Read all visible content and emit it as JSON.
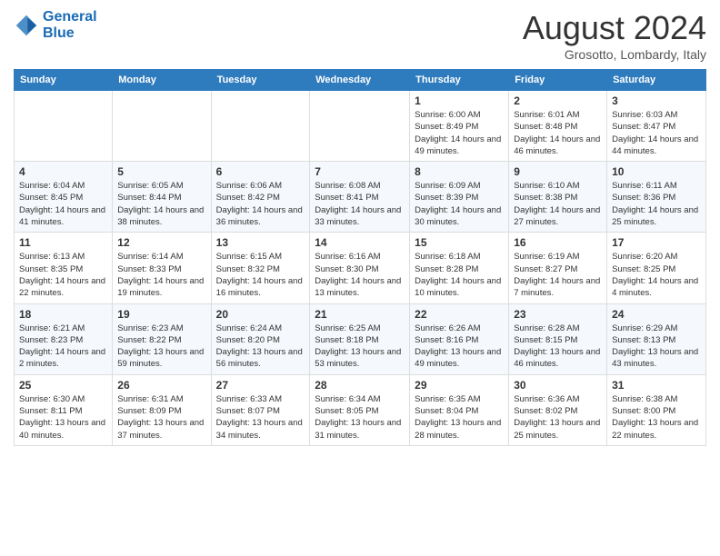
{
  "header": {
    "logo_line1": "General",
    "logo_line2": "Blue",
    "month_title": "August 2024",
    "subtitle": "Grosotto, Lombardy, Italy"
  },
  "weekdays": [
    "Sunday",
    "Monday",
    "Tuesday",
    "Wednesday",
    "Thursday",
    "Friday",
    "Saturday"
  ],
  "weeks": [
    [
      {
        "day": "",
        "info": ""
      },
      {
        "day": "",
        "info": ""
      },
      {
        "day": "",
        "info": ""
      },
      {
        "day": "",
        "info": ""
      },
      {
        "day": "1",
        "info": "Sunrise: 6:00 AM\nSunset: 8:49 PM\nDaylight: 14 hours and 49 minutes."
      },
      {
        "day": "2",
        "info": "Sunrise: 6:01 AM\nSunset: 8:48 PM\nDaylight: 14 hours and 46 minutes."
      },
      {
        "day": "3",
        "info": "Sunrise: 6:03 AM\nSunset: 8:47 PM\nDaylight: 14 hours and 44 minutes."
      }
    ],
    [
      {
        "day": "4",
        "info": "Sunrise: 6:04 AM\nSunset: 8:45 PM\nDaylight: 14 hours and 41 minutes."
      },
      {
        "day": "5",
        "info": "Sunrise: 6:05 AM\nSunset: 8:44 PM\nDaylight: 14 hours and 38 minutes."
      },
      {
        "day": "6",
        "info": "Sunrise: 6:06 AM\nSunset: 8:42 PM\nDaylight: 14 hours and 36 minutes."
      },
      {
        "day": "7",
        "info": "Sunrise: 6:08 AM\nSunset: 8:41 PM\nDaylight: 14 hours and 33 minutes."
      },
      {
        "day": "8",
        "info": "Sunrise: 6:09 AM\nSunset: 8:39 PM\nDaylight: 14 hours and 30 minutes."
      },
      {
        "day": "9",
        "info": "Sunrise: 6:10 AM\nSunset: 8:38 PM\nDaylight: 14 hours and 27 minutes."
      },
      {
        "day": "10",
        "info": "Sunrise: 6:11 AM\nSunset: 8:36 PM\nDaylight: 14 hours and 25 minutes."
      }
    ],
    [
      {
        "day": "11",
        "info": "Sunrise: 6:13 AM\nSunset: 8:35 PM\nDaylight: 14 hours and 22 minutes."
      },
      {
        "day": "12",
        "info": "Sunrise: 6:14 AM\nSunset: 8:33 PM\nDaylight: 14 hours and 19 minutes."
      },
      {
        "day": "13",
        "info": "Sunrise: 6:15 AM\nSunset: 8:32 PM\nDaylight: 14 hours and 16 minutes."
      },
      {
        "day": "14",
        "info": "Sunrise: 6:16 AM\nSunset: 8:30 PM\nDaylight: 14 hours and 13 minutes."
      },
      {
        "day": "15",
        "info": "Sunrise: 6:18 AM\nSunset: 8:28 PM\nDaylight: 14 hours and 10 minutes."
      },
      {
        "day": "16",
        "info": "Sunrise: 6:19 AM\nSunset: 8:27 PM\nDaylight: 14 hours and 7 minutes."
      },
      {
        "day": "17",
        "info": "Sunrise: 6:20 AM\nSunset: 8:25 PM\nDaylight: 14 hours and 4 minutes."
      }
    ],
    [
      {
        "day": "18",
        "info": "Sunrise: 6:21 AM\nSunset: 8:23 PM\nDaylight: 14 hours and 2 minutes."
      },
      {
        "day": "19",
        "info": "Sunrise: 6:23 AM\nSunset: 8:22 PM\nDaylight: 13 hours and 59 minutes."
      },
      {
        "day": "20",
        "info": "Sunrise: 6:24 AM\nSunset: 8:20 PM\nDaylight: 13 hours and 56 minutes."
      },
      {
        "day": "21",
        "info": "Sunrise: 6:25 AM\nSunset: 8:18 PM\nDaylight: 13 hours and 53 minutes."
      },
      {
        "day": "22",
        "info": "Sunrise: 6:26 AM\nSunset: 8:16 PM\nDaylight: 13 hours and 49 minutes."
      },
      {
        "day": "23",
        "info": "Sunrise: 6:28 AM\nSunset: 8:15 PM\nDaylight: 13 hours and 46 minutes."
      },
      {
        "day": "24",
        "info": "Sunrise: 6:29 AM\nSunset: 8:13 PM\nDaylight: 13 hours and 43 minutes."
      }
    ],
    [
      {
        "day": "25",
        "info": "Sunrise: 6:30 AM\nSunset: 8:11 PM\nDaylight: 13 hours and 40 minutes."
      },
      {
        "day": "26",
        "info": "Sunrise: 6:31 AM\nSunset: 8:09 PM\nDaylight: 13 hours and 37 minutes."
      },
      {
        "day": "27",
        "info": "Sunrise: 6:33 AM\nSunset: 8:07 PM\nDaylight: 13 hours and 34 minutes."
      },
      {
        "day": "28",
        "info": "Sunrise: 6:34 AM\nSunset: 8:05 PM\nDaylight: 13 hours and 31 minutes."
      },
      {
        "day": "29",
        "info": "Sunrise: 6:35 AM\nSunset: 8:04 PM\nDaylight: 13 hours and 28 minutes."
      },
      {
        "day": "30",
        "info": "Sunrise: 6:36 AM\nSunset: 8:02 PM\nDaylight: 13 hours and 25 minutes."
      },
      {
        "day": "31",
        "info": "Sunrise: 6:38 AM\nSunset: 8:00 PM\nDaylight: 13 hours and 22 minutes."
      }
    ]
  ]
}
